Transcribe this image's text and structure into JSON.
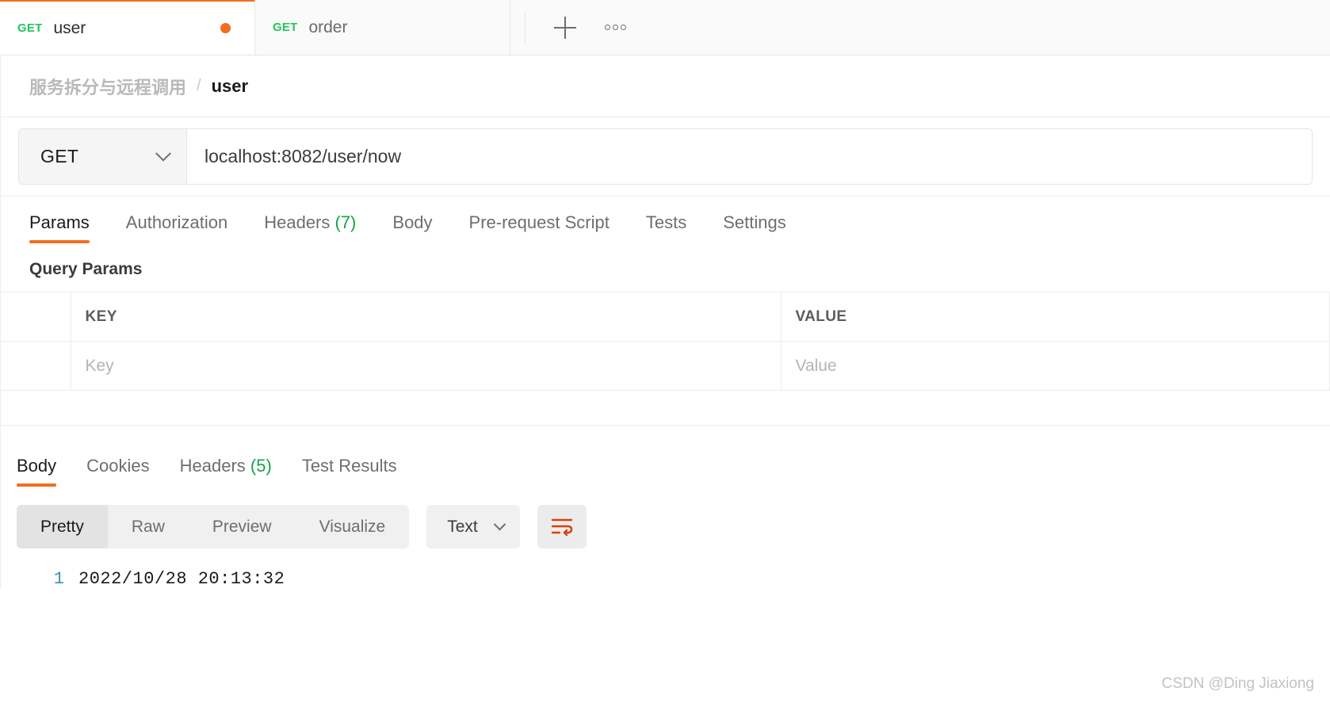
{
  "tabs": {
    "items": [
      {
        "method": "GET",
        "name": "user",
        "active": true,
        "unsaved": true
      },
      {
        "method": "GET",
        "name": "order",
        "active": false,
        "unsaved": false
      }
    ],
    "new_tab_icon": "plus-icon",
    "more_icon": "ellipsis-icon"
  },
  "breadcrumb": {
    "collection": "服务拆分与远程调用",
    "separator": "/",
    "current": "user"
  },
  "request": {
    "method": "GET",
    "url": "localhost:8082/user/now",
    "tabs": [
      {
        "label": "Params",
        "count": "",
        "active": true
      },
      {
        "label": "Authorization",
        "count": "",
        "active": false
      },
      {
        "label": "Headers",
        "count": "(7)",
        "active": false
      },
      {
        "label": "Body",
        "count": "",
        "active": false
      },
      {
        "label": "Pre-request Script",
        "count": "",
        "active": false
      },
      {
        "label": "Tests",
        "count": "",
        "active": false
      },
      {
        "label": "Settings",
        "count": "",
        "active": false
      }
    ],
    "params_title": "Query Params",
    "params_table": {
      "headers": [
        "",
        "KEY",
        "VALUE"
      ],
      "rows": [
        {
          "key_placeholder": "Key",
          "value_placeholder": "Value"
        }
      ]
    }
  },
  "response": {
    "tabs": [
      {
        "label": "Body",
        "count": "",
        "active": true
      },
      {
        "label": "Cookies",
        "count": "",
        "active": false
      },
      {
        "label": "Headers",
        "count": "(5)",
        "active": false
      },
      {
        "label": "Test Results",
        "count": "",
        "active": false
      }
    ],
    "view_modes": [
      {
        "label": "Pretty",
        "active": true
      },
      {
        "label": "Raw",
        "active": false
      },
      {
        "label": "Preview",
        "active": false
      },
      {
        "label": "Visualize",
        "active": false
      }
    ],
    "format": "Text",
    "wrap_icon": "word-wrap-icon",
    "body_lines": [
      {
        "number": "1",
        "text": "2022/10/28 20:13:32"
      }
    ]
  },
  "watermark": "CSDN @Ding Jiaxiong",
  "colors": {
    "accent_orange": "#f26d21",
    "method_green": "#22c55e",
    "count_green": "#16a34a",
    "wrap_orange": "#d9410b",
    "line_number_blue": "#3a8fb7"
  }
}
